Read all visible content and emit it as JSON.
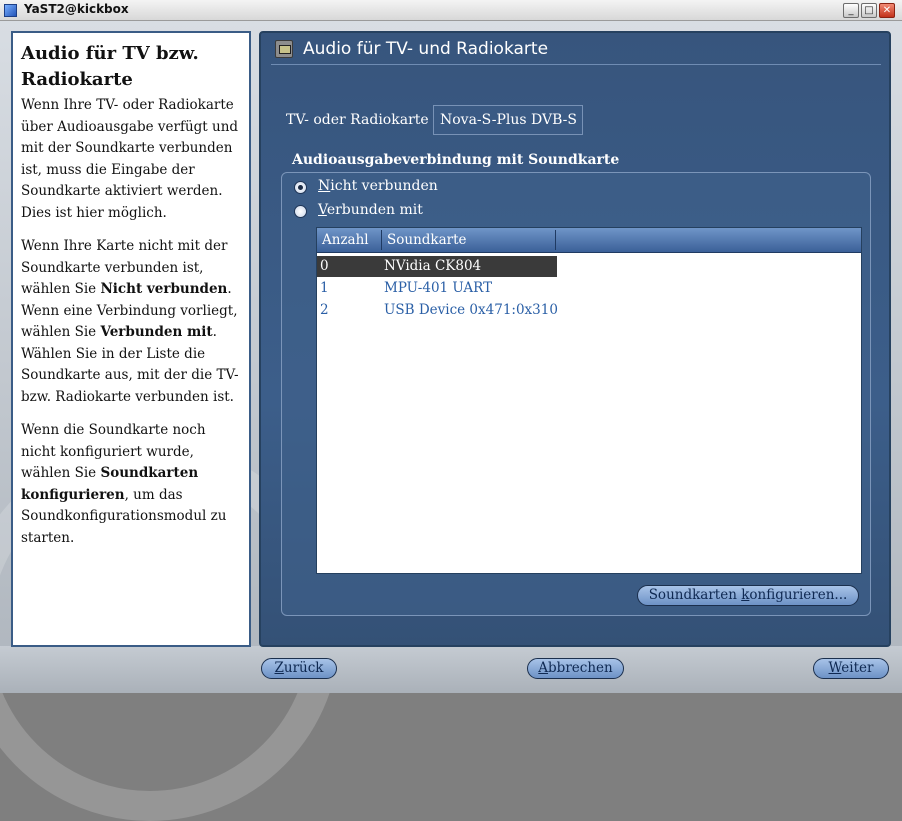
{
  "window": {
    "title": "YaST2@kickbox",
    "min_glyph": "_",
    "max_glyph": "□",
    "close_glyph": "✕"
  },
  "help": {
    "heading": "Audio für TV bzw. Radiokarte",
    "p1": "Wenn Ihre TV- oder Radiokarte über Audioausgabe verfügt und mit der Soundkarte verbunden ist, muss die Eingabe der Soundkarte aktiviert werden. Dies ist hier möglich.",
    "p2_a": "Wenn Ihre Karte nicht mit der Soundkarte verbunden ist, wählen Sie ",
    "p2_b": "Nicht verbunden",
    "p2_c": ". Wenn eine Verbindung vorliegt, wählen Sie ",
    "p2_d": "Verbunden mit",
    "p2_e": ". Wählen Sie in der Liste die Soundkarte aus, mit der die TV- bzw. Radiokarte verbunden ist.",
    "p3_a": "Wenn die Soundkarte noch nicht konfiguriert wurde, wählen Sie ",
    "p3_b": "Soundkarten konfigurieren",
    "p3_c": ", um das Soundkonfigurationsmodul zu starten."
  },
  "panel": {
    "title": "Audio für TV- und Radiokarte",
    "tv_label": "TV- oder Radiokarte",
    "tv_value": "Nova-S-Plus DVB-S",
    "group_title": "Audioausgabeverbindung mit Soundkarte",
    "radio_not_connected_key": "N",
    "radio_not_connected_rest": "icht verbunden",
    "radio_connected_key": "V",
    "radio_connected_rest": "erbunden mit",
    "table": {
      "col_count": "Anzahl",
      "col_card": "Soundkarte",
      "rows": [
        {
          "num": "0",
          "card": "NVidia CK804"
        },
        {
          "num": "1",
          "card": "MPU-401 UART"
        },
        {
          "num": "2",
          "card": "USB Device 0x471:0x310"
        }
      ]
    },
    "configure_a": "Soundkarten ",
    "configure_key": "k",
    "configure_b": "onfigurieren..."
  },
  "footer": {
    "back_key": "Z",
    "back_rest": "urück",
    "cancel_key": "A",
    "cancel_rest": "bbrechen",
    "next_key": "W",
    "next_rest": "eiter"
  }
}
